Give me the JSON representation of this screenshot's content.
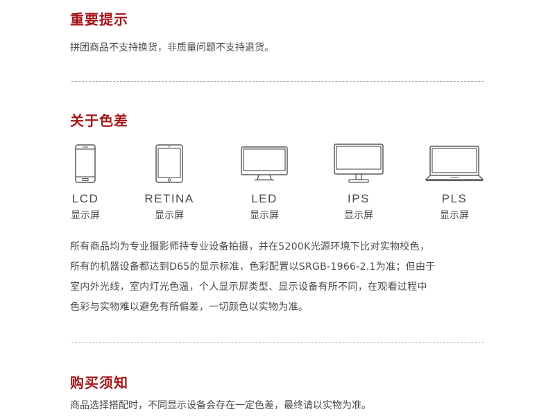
{
  "notice": {
    "title": "重要提示",
    "text": "拼团商品不支持换货，非质量问题不支持退货。"
  },
  "color_diff": {
    "title": "关于色差",
    "devices": [
      {
        "name": "LCD",
        "sub": "显示屏",
        "icon": "smartphone-icon"
      },
      {
        "name": "RETINA",
        "sub": "显示屏",
        "icon": "tablet-icon"
      },
      {
        "name": "LED",
        "sub": "显示屏",
        "icon": "desktop-monitor-icon"
      },
      {
        "name": "IPS",
        "sub": "显示屏",
        "icon": "monitor-icon"
      },
      {
        "name": "PLS",
        "sub": "显示屏",
        "icon": "laptop-icon"
      }
    ],
    "paragraph_lines": [
      "所有商品均为专业摄影师持专业设备拍摄，并在5200K光源环境下比对实物校色，",
      "所有的机器设备都达到D65的显示标准，色彩配置以SRGB-1966-2.1为准；但由于",
      "室内外光线，室内灯光色温，个人显示屏类型、显示设备有所不同，在观看过程中",
      "色彩与实物难以避免有所偏差，一切颜色以实物为准。"
    ]
  },
  "purchase": {
    "title": "购买须知",
    "text": "商品选择搭配时，不同显示设备会存在一定色差，最终请以实物为准。"
  },
  "colors": {
    "title": "#a3171b",
    "text": "#4a4a4a",
    "divider": "#a9a9a9",
    "icon_stroke": "#5a5a5a"
  }
}
